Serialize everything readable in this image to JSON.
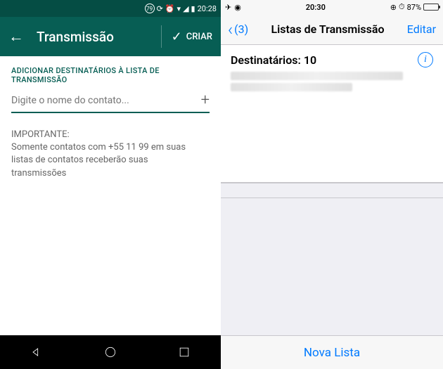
{
  "android": {
    "statusbar": {
      "badge": "79",
      "time": "20:28"
    },
    "header": {
      "title": "Transmissão",
      "action_label": "CRIAR"
    },
    "section_label": "ADICIONAR DESTINATÁRIOS À LISTA DE TRANSMISSÃO",
    "input_placeholder": "Digite o nome do contato...",
    "note_title": "IMPORTANTE:",
    "note_body": "Somente contatos com +55 11 99           em suas listas de contatos receberão suas transmissões"
  },
  "ios": {
    "statusbar": {
      "time": "20:30",
      "battery": "87%"
    },
    "header": {
      "back_count": "(3)",
      "title": "Listas de Transmissão",
      "edit_label": "Editar"
    },
    "recipients_label": "Destinatários: 10",
    "new_list_label": "Nova Lista"
  }
}
